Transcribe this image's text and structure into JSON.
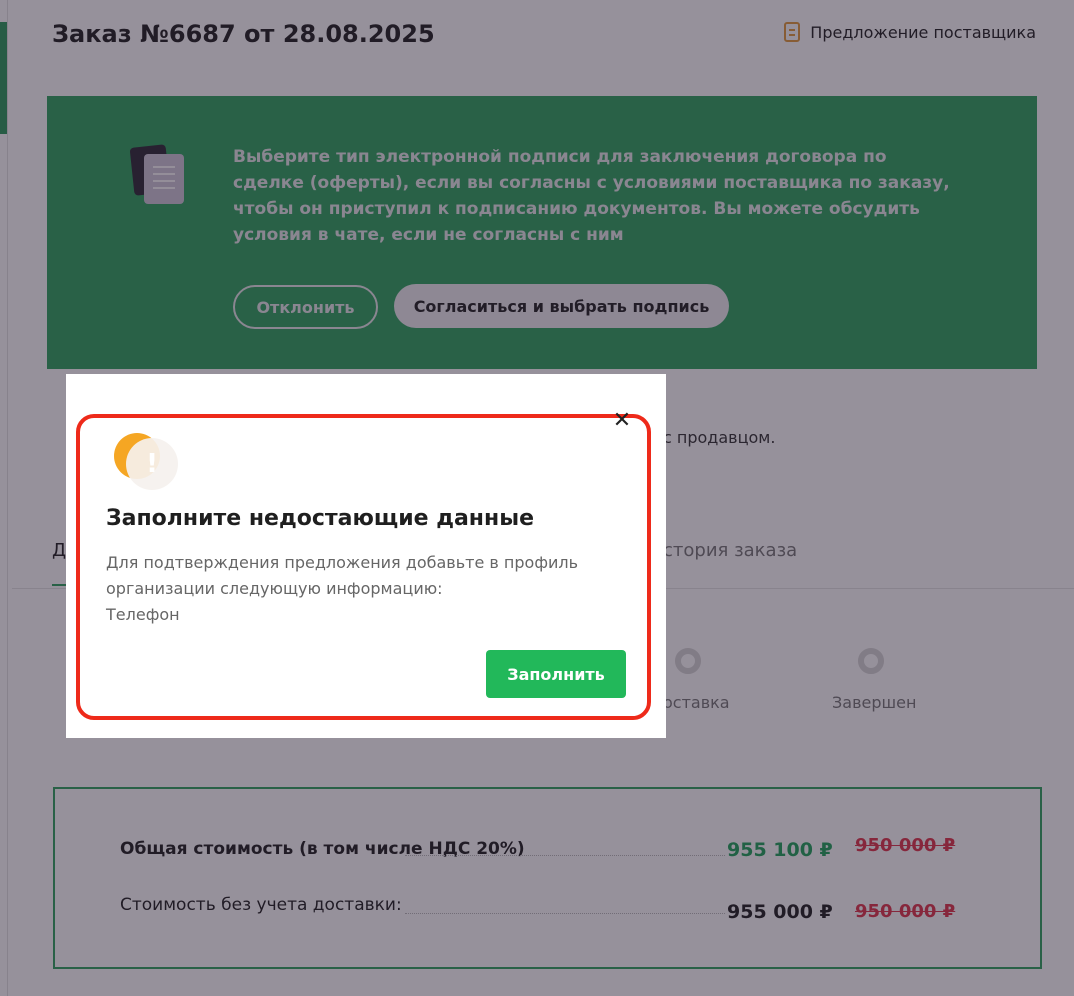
{
  "order": {
    "title": "Заказ №6687 от 28.08.2025",
    "supplier_link_label": "Предложение поставщика"
  },
  "banner": {
    "text": "Выберите тип электронной подписи для заключения договора по сделке (оферты), если вы согласны с условиями поставщика по заказу, чтобы он приступил к подписанию документов. Вы можете обсудить условия в чате, если не согласны с ним",
    "decline_label": "Отклонить",
    "agree_label": "Согласиться и выбрать подпись"
  },
  "background": {
    "under_banner_text": "с продавцом.",
    "tab_first_label": "Д",
    "tab_history_label": "стория заказа",
    "steps": [
      {
        "label": "оставка"
      },
      {
        "label": "Завершен"
      }
    ]
  },
  "pricing": {
    "total_label": "Общая стоимость (в том числе НДС 20%)",
    "total_new": "955 100 ₽",
    "total_old": "950 000 ₽",
    "no_delivery_label": "Стоимость без учета доставки:",
    "no_delivery_new": "955 000 ₽",
    "no_delivery_old": "950 000 ₽"
  },
  "modal": {
    "title": "Заполните недостающие данные",
    "description": "Для подтверждения предложения добавьте в профиль организации следующую информацию:",
    "missing_field": "Телефон",
    "fill_label": "Заполнить",
    "close_symbol": "✕",
    "warning_symbol": "!"
  },
  "colors": {
    "brand_green": "#2ea35f",
    "button_green": "#22b85a",
    "warning_orange": "#f5a623",
    "highlight_red": "#ee2a1a",
    "old_price_red": "#e0344a"
  },
  "icons": {
    "supplier_link": "document-icon",
    "banner": "documents-icon",
    "modal": "warning-icon",
    "close": "close-icon"
  }
}
